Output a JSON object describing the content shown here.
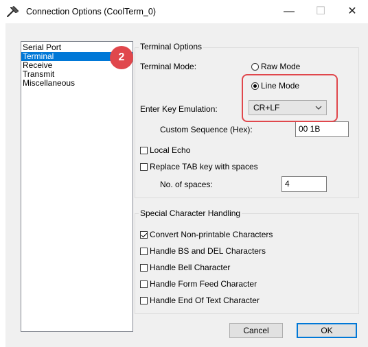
{
  "window": {
    "title": "Connection Options (CoolTerm_0)",
    "controls": {
      "minimize": "—",
      "maximize": "☐",
      "close": "✕"
    }
  },
  "nav": {
    "items": [
      {
        "label": "Serial Port",
        "selected": false
      },
      {
        "label": "Terminal",
        "selected": true
      },
      {
        "label": "Receive",
        "selected": false
      },
      {
        "label": "Transmit",
        "selected": false
      },
      {
        "label": "Miscellaneous",
        "selected": false
      }
    ]
  },
  "annotation": {
    "badge": "2",
    "accent_color": "#e0474c"
  },
  "terminal_options": {
    "group_label": "Terminal Options",
    "mode_label": "Terminal Mode:",
    "raw_mode": {
      "label": "Raw Mode",
      "checked": false
    },
    "line_mode": {
      "label": "Line Mode",
      "checked": true
    },
    "enter_key_label": "Enter Key Emulation:",
    "enter_key_value": "CR+LF",
    "custom_seq_label": "Custom Sequence (Hex):",
    "custom_seq_value": "00 1B",
    "local_echo": {
      "label": "Local Echo",
      "checked": false
    },
    "replace_tab": {
      "label": "Replace TAB key with spaces",
      "checked": false
    },
    "spaces_label": "No. of spaces:",
    "spaces_value": "4"
  },
  "special_chars": {
    "group_label": "Special Character Handling",
    "items": [
      {
        "label": "Convert Non-printable Characters",
        "checked": true
      },
      {
        "label": "Handle BS and DEL Characters",
        "checked": false
      },
      {
        "label": "Handle Bell Character",
        "checked": false
      },
      {
        "label": "Handle Form Feed Character",
        "checked": false
      },
      {
        "label": "Handle End Of Text Character",
        "checked": false
      }
    ]
  },
  "buttons": {
    "cancel": "Cancel",
    "ok": "OK"
  },
  "colors": {
    "selection": "#0078d7",
    "annotation": "#e0474c",
    "dialog_bg": "#f0f0f0"
  }
}
